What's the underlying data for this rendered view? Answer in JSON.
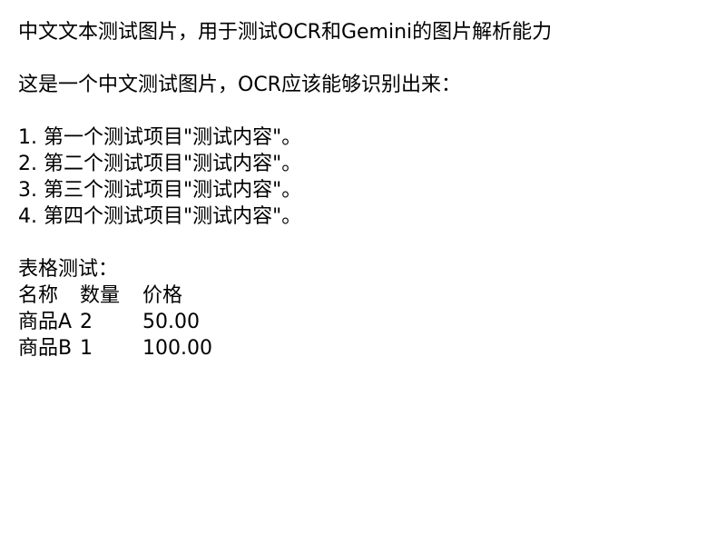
{
  "document": {
    "title": "中文文本测试图片，用于测试OCR和Gemini的图片解析能力",
    "subtitle": "这是一个中文测试图片，OCR应该能够识别出来：",
    "list_items": [
      "1. 第一个测试项目\"测试内容\"。",
      "2. 第二个测试项目\"测试内容\"。",
      "3. 第三个测试项目\"测试内容\"。",
      "4. 第四个测试项目\"测试内容\"。"
    ],
    "table_title": "表格测试：",
    "table": {
      "headers": [
        "名称",
        "数量",
        "价格"
      ],
      "rows": [
        [
          "商品A",
          "2",
          "50.00"
        ],
        [
          "商品B",
          "1",
          "100.00"
        ]
      ]
    }
  }
}
